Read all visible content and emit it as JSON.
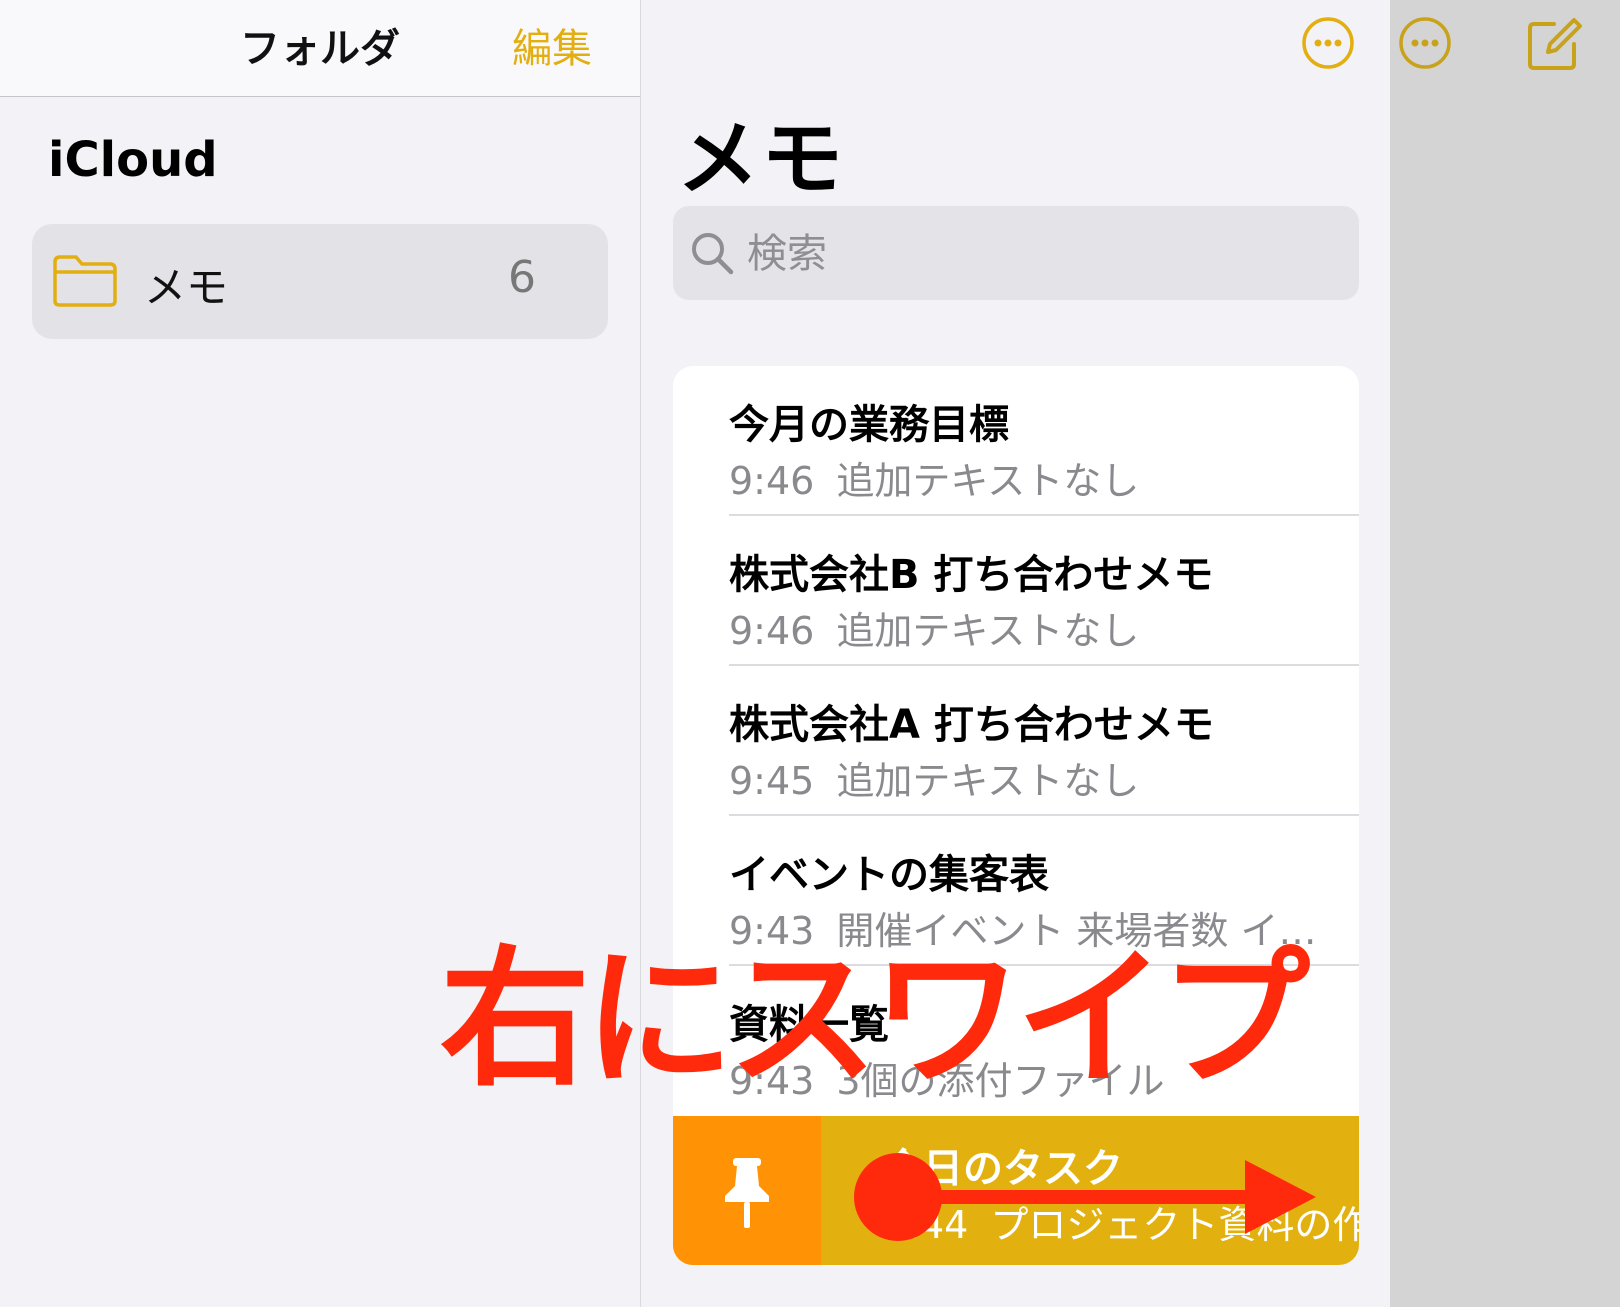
{
  "sidebar": {
    "title": "フォルダ",
    "edit_label": "編集",
    "account": "iCloud",
    "folders": [
      {
        "label": "メモ",
        "count": "6"
      }
    ]
  },
  "notes_list": {
    "title": "メモ",
    "search_placeholder": "検索",
    "notes": [
      {
        "title": "今月の業務目標",
        "time": "9:46",
        "preview": "追加テキストなし"
      },
      {
        "title": "株式会社B 打ち合わせメモ",
        "time": "9:46",
        "preview": "追加テキストなし"
      },
      {
        "title": "株式会社A 打ち合わせメモ",
        "time": "9:45",
        "preview": "追加テキストなし"
      },
      {
        "title": "イベントの集客表",
        "time": "9:43",
        "preview": "開催イベント 来場者数 イ…"
      },
      {
        "title": "資料一覧",
        "time": "9:43",
        "preview": "3個の添付ファイル"
      }
    ],
    "swiped_note": {
      "title": "今日のタスク",
      "time": "9:44",
      "preview": "プロジェクト資料の作"
    }
  },
  "overlay": {
    "instruction": "右にスワイプ"
  },
  "icons": {
    "folder": "folder-icon",
    "more": "ellipsis-circle-icon",
    "compose": "compose-icon",
    "search": "magnifier-icon",
    "pin": "pin-icon"
  },
  "colors": {
    "accent": "#e3ae10",
    "pin_action": "#ff9305",
    "swipe_row": "#e3b10f",
    "overlay_red": "#ff2a0c"
  }
}
